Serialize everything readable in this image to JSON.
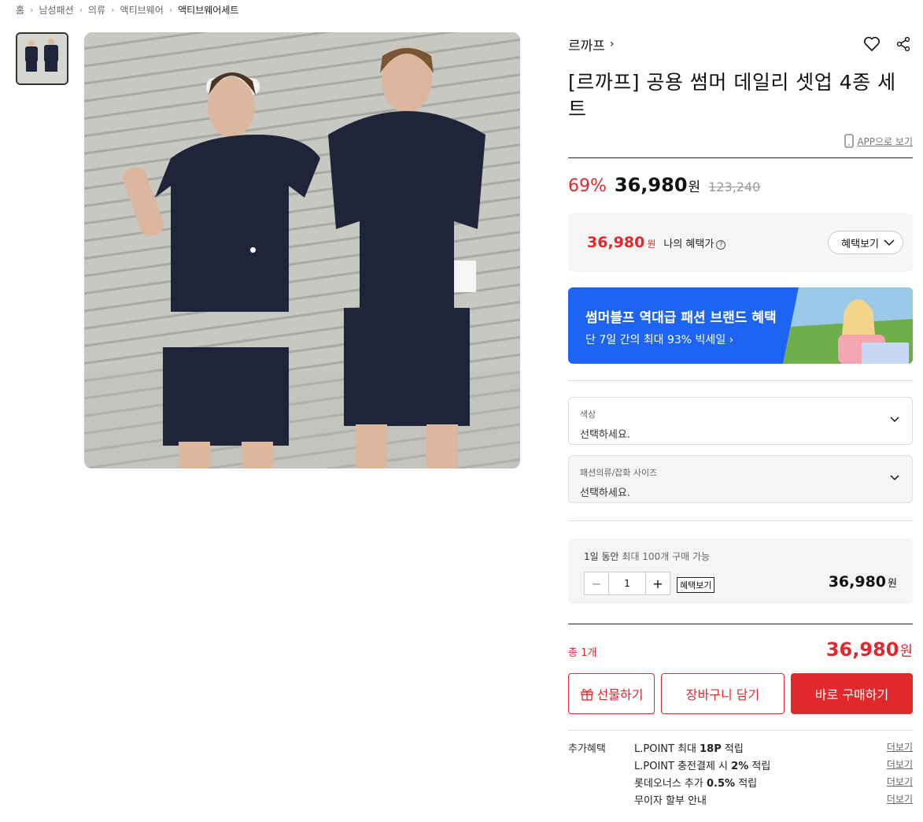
{
  "breadcrumb": [
    "홈",
    "남성패션",
    "의류",
    "액티브웨어",
    "액티브웨어세트"
  ],
  "product": {
    "brand": "르까프",
    "title": "[르까프] 공용 썸머 데일리 셋업 4종 세트",
    "app_link": "APP으로 보기"
  },
  "price": {
    "discount": "69%",
    "sale": "36,980",
    "won": "원",
    "original": "123,240"
  },
  "my_benefit": {
    "price": "36,980",
    "won": "원",
    "label": "나의 혜택가",
    "button": "혜택보기"
  },
  "banner": {
    "title": "썸머블프 역대급 패션 브랜드 혜택",
    "subtitle": "단 7일 간의 최대 93% 빅세일 ›"
  },
  "options": [
    {
      "label": "색상",
      "value": "선택하세요."
    },
    {
      "label": "패션의류/잡화 사이즈",
      "value": "선택하세요."
    }
  ],
  "quantity": {
    "limit_prefix": "1일 동안",
    "limit_middle": "최대 100개",
    "limit_suffix": "구매 가능",
    "value": "1",
    "minus": "−",
    "plus": "+",
    "benefit_button": "혜택보기",
    "price": "36,980",
    "won": "원"
  },
  "total": {
    "label": "총 1개",
    "price": "36,980",
    "won": "원"
  },
  "actions": {
    "gift": "선물하기",
    "cart": "장바구니 담기",
    "buy": "바로 구매하기"
  },
  "extra_benefits": {
    "label": "추가혜택",
    "more": "더보기",
    "rows": [
      {
        "pre": "L.POINT 최대 ",
        "bold": "18P",
        "post": " 적립"
      },
      {
        "pre": "L.POINT 충전결제 시 ",
        "bold": "2%",
        "post": " 적립"
      },
      {
        "pre": "롯데오너스 추가 ",
        "bold": "0.5%",
        "post": " 적립"
      },
      {
        "pre": "무이자 할부 안내",
        "bold": "",
        "post": ""
      }
    ]
  },
  "colors": {
    "accent_red": "#e0282d",
    "banner_blue": "#1d64f2"
  }
}
